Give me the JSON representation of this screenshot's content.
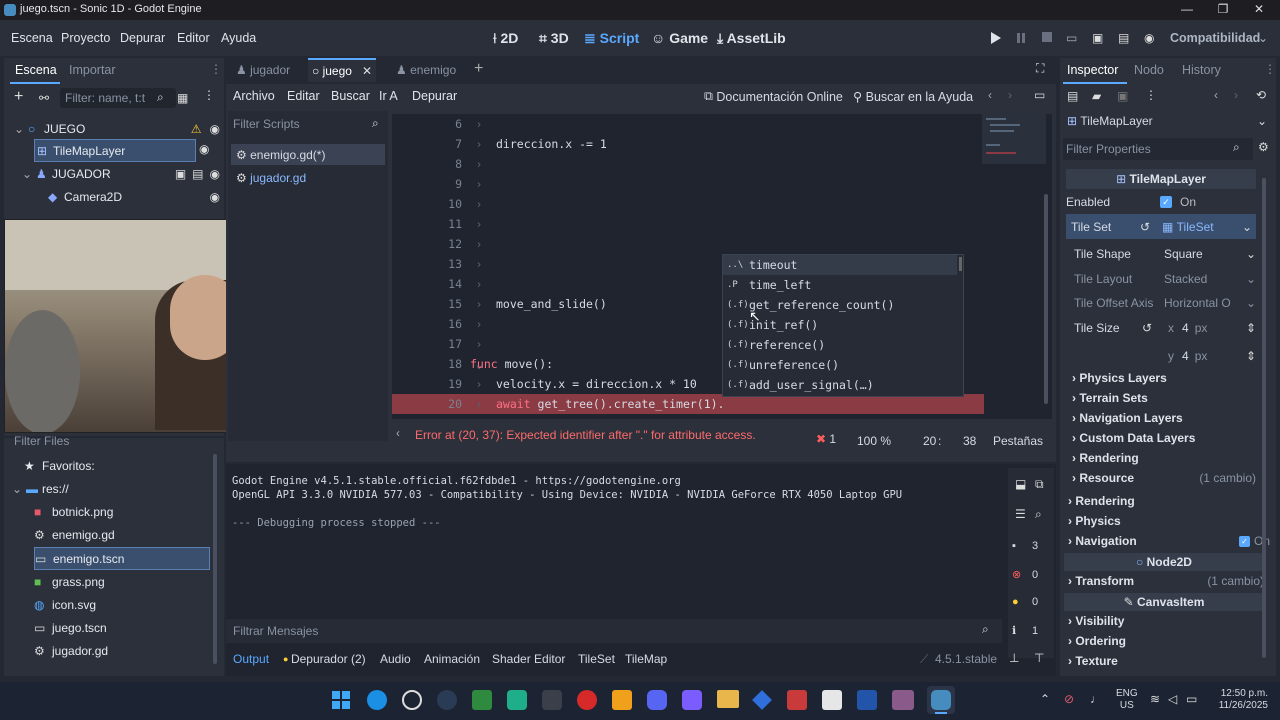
{
  "window": {
    "title": "juego.tscn - Sonic 1D - Godot Engine",
    "buttons": [
      "—",
      "❐",
      "✕"
    ]
  },
  "menu": {
    "items": [
      "Escena",
      "Proyecto",
      "Depurar",
      "Editor",
      "Ayuda"
    ],
    "modes": [
      "2D",
      "3D",
      "Script",
      "Game",
      "AssetLib"
    ],
    "renderer": "Compatibilidad"
  },
  "scene_dock": {
    "tabs": [
      "Escena",
      "Importar"
    ],
    "filter_placeholder": "Filter: name, t:t",
    "tree": [
      {
        "label": "JUEGO"
      },
      {
        "label": "TileMapLayer"
      },
      {
        "label": "JUGADOR"
      },
      {
        "label": "Camera2D"
      }
    ]
  },
  "filesystem": {
    "title": "Filter Files",
    "items": [
      {
        "label": "Favoritos:"
      },
      {
        "label": "res://"
      },
      {
        "label": "botnick.png"
      },
      {
        "label": "enemigo.gd"
      },
      {
        "label": "enemigo.tscn"
      },
      {
        "label": "grass.png"
      },
      {
        "label": "icon.svg"
      },
      {
        "label": "juego.tscn"
      },
      {
        "label": "jugador.gd"
      }
    ]
  },
  "editor_tabs": [
    "jugador",
    "juego",
    "enemigo"
  ],
  "script_menu": {
    "items": [
      "Archivo",
      "Editar",
      "Buscar",
      "Ir A",
      "Depurar"
    ],
    "doc": "Documentación Online",
    "help": "Buscar en la Ayuda"
  },
  "scripts": {
    "filter_placeholder": "Filter Scripts",
    "list": [
      "enemigo.gd(*)",
      "jugador.gd"
    ]
  },
  "code": [
    {
      "n": "6",
      "text": ""
    },
    {
      "n": "7",
      "text": "direccion.x -= 1"
    },
    {
      "n": "8",
      "text": ""
    },
    {
      "n": "9",
      "text": ""
    },
    {
      "n": "10",
      "text": ""
    },
    {
      "n": "11",
      "text": ""
    },
    {
      "n": "12",
      "text": ""
    },
    {
      "n": "13",
      "text": ""
    },
    {
      "n": "14",
      "text": ""
    },
    {
      "n": "15",
      "text": "move_and_slide()"
    },
    {
      "n": "16",
      "text": ""
    },
    {
      "n": "17",
      "text": ""
    },
    {
      "n": "18",
      "kw": "func",
      "text": " move():"
    },
    {
      "n": "19",
      "text": "velocity.x = direccion.x * 10"
    },
    {
      "n": "20",
      "kw": "await",
      "text": " get_tree().create_timer(1)."
    }
  ],
  "autocomplete": [
    {
      "kind": "..\\",
      "label": "timeout"
    },
    {
      "kind": ".P",
      "label": "time_left"
    },
    {
      "kind": "(.f)",
      "label": "get_reference_count()"
    },
    {
      "kind": "(.f)",
      "label": "init_ref()"
    },
    {
      "kind": "(.f)",
      "label": "reference()"
    },
    {
      "kind": "(.f)",
      "label": "unreference()"
    },
    {
      "kind": "(.f)",
      "label": "add_user_signal(…)"
    }
  ],
  "status": {
    "error": "Error at (20, 37): Expected identifier after \".\" for attribute access.",
    "errors": "1",
    "zoom": "100 %",
    "line": "20",
    "col": "38",
    "indent": "Pestañas"
  },
  "output": {
    "lines": [
      "Godot Engine v4.5.1.stable.official.f62fdbde1 - https://godotengine.org",
      "OpenGL API 3.3.0 NVIDIA 577.03 - Compatibility - Using Device: NVIDIA - NVIDIA GeForce RTX 4050 Laptop GPU",
      "",
      "--- Debugging process stopped ---"
    ],
    "filter_placeholder": "Filtrar Mensajes",
    "counts": [
      "3",
      "0",
      "0",
      "1"
    ]
  },
  "bottom_tabs": [
    "Output",
    "Depurador (2)",
    "Audio",
    "Animación",
    "Shader Editor",
    "TileSet",
    "TileMap"
  ],
  "version": "4.5.1.stable",
  "inspector": {
    "tabs": [
      "Inspector",
      "Nodo",
      "History"
    ],
    "node": "TileMapLayer",
    "filter_placeholder": "Filter Properties",
    "class_header": "TileMapLayer",
    "enabled_label": "Enabled",
    "enabled_value": "On",
    "tileset_label": "Tile Set",
    "tileset_value": "TileSet",
    "tile_shape_label": "Tile Shape",
    "tile_shape_value": "Square",
    "tile_layout_label": "Tile Layout",
    "tile_layout_value": "Stacked",
    "tile_offset_label": "Tile Offset Axis",
    "tile_offset_value": "Horizontal O",
    "tile_size_label": "Tile Size",
    "tile_size_x": "4",
    "tile_size_y": "4",
    "unit": "px",
    "sections": [
      "Physics Layers",
      "Terrain Sets",
      "Navigation Layers",
      "Custom Data Layers",
      "Rendering"
    ],
    "resource_label": "Resource",
    "resource_change": "(1 cambio)",
    "rendering": "Rendering",
    "physics": "Physics",
    "navigation": "Navigation",
    "navigation_value": "On",
    "node2d": "Node2D",
    "transform": "Transform",
    "transform_change": "(1 cambio)",
    "canvasitem": "CanvasItem",
    "visibility": "Visibility",
    "ordering": "Ordering",
    "texture": "Texture"
  },
  "taskbar": {
    "lang": "ENG",
    "region": "US",
    "time": "12:50 p.m.",
    "date": "11/26/2025"
  },
  "colors": {
    "accent": "#5aa9ff",
    "error_line": "#8a3b44",
    "keyword": "#ff7085",
    "warning": "#ffcc33",
    "error": "#ff5d5d"
  }
}
